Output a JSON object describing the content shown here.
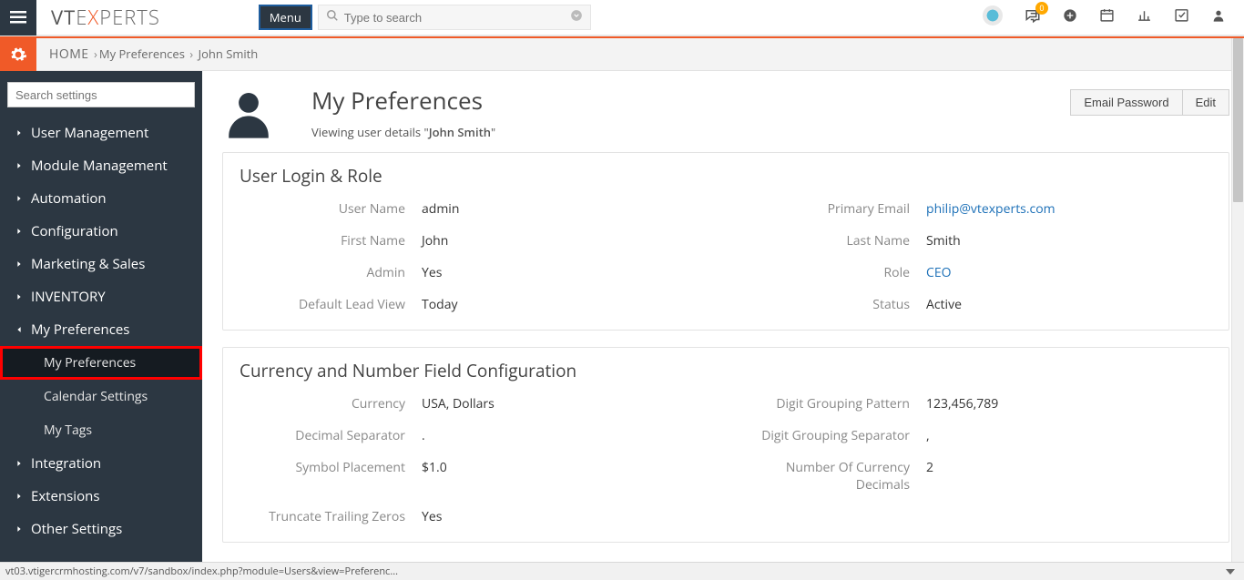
{
  "topbar": {
    "menu_label": "Menu",
    "search_placeholder": "Type to search",
    "notification_count": "0"
  },
  "breadcrumb": {
    "home": "HOME",
    "level1": "My Preferences",
    "level2": "John Smith"
  },
  "sidebar": {
    "search_placeholder": "Search settings",
    "items": [
      {
        "label": "User Management"
      },
      {
        "label": "Module Management"
      },
      {
        "label": "Automation"
      },
      {
        "label": "Configuration"
      },
      {
        "label": "Marketing & Sales"
      },
      {
        "label": "INVENTORY"
      },
      {
        "label": "My Preferences",
        "expanded": true,
        "children": [
          {
            "label": "My Preferences",
            "active": true,
            "highlighted": true
          },
          {
            "label": "Calendar Settings"
          },
          {
            "label": "My Tags"
          }
        ]
      },
      {
        "label": "Integration"
      },
      {
        "label": "Extensions"
      },
      {
        "label": "Other Settings"
      }
    ]
  },
  "header": {
    "title": "My Preferences",
    "subtitle_prefix": "Viewing user details  \"",
    "subtitle_name": "John Smith",
    "subtitle_suffix": "\"",
    "actions": {
      "email_password": "Email Password",
      "edit": "Edit"
    }
  },
  "panels": {
    "login_role": {
      "title": "User Login & Role",
      "fields": {
        "user_name": {
          "label": "User Name",
          "value": "admin"
        },
        "primary_email": {
          "label": "Primary Email",
          "value": "philip@vtexperts.com",
          "link": true
        },
        "first_name": {
          "label": "First Name",
          "value": "John"
        },
        "last_name": {
          "label": "Last Name",
          "value": "Smith"
        },
        "admin": {
          "label": "Admin",
          "value": "Yes"
        },
        "role": {
          "label": "Role",
          "value": "CEO",
          "link": true
        },
        "default_lead_view": {
          "label": "Default Lead View",
          "value": "Today"
        },
        "status": {
          "label": "Status",
          "value": "Active"
        }
      }
    },
    "currency": {
      "title": "Currency and Number Field Configuration",
      "fields": {
        "currency": {
          "label": "Currency",
          "value": "USA, Dollars"
        },
        "digit_grouping_pattern": {
          "label": "Digit Grouping Pattern",
          "value": "123,456,789"
        },
        "decimal_separator": {
          "label": "Decimal Separator",
          "value": "."
        },
        "digit_grouping_separator": {
          "label": "Digit Grouping Separator",
          "value": ","
        },
        "symbol_placement": {
          "label": "Symbol Placement",
          "value": "$1.0"
        },
        "number_of_currency_decimals": {
          "label": "Number Of Currency Decimals",
          "value": "2"
        },
        "truncate_trailing_zeros": {
          "label": "Truncate Trailing Zeros",
          "value": "Yes"
        }
      }
    }
  },
  "statusbar": {
    "url": "vt03.vtigercrmhosting.com/v7/sandbox/index.php?module=Users&view=Preferenc..."
  }
}
